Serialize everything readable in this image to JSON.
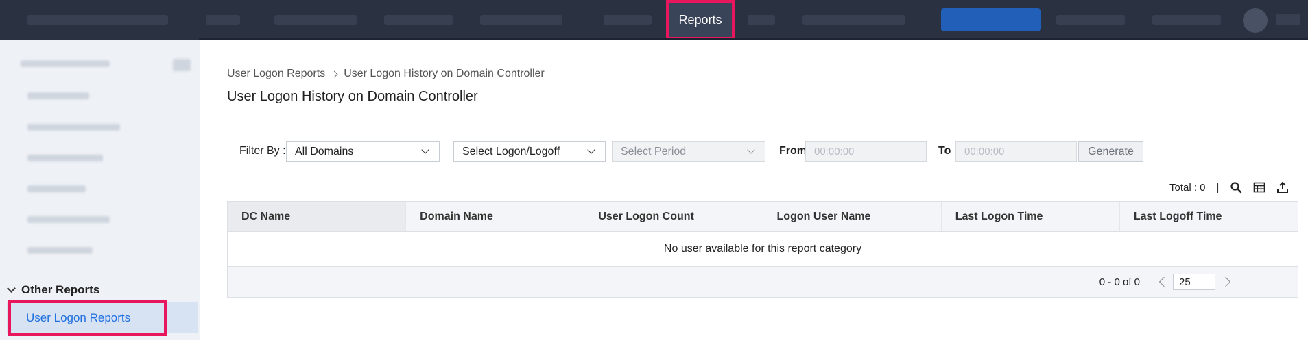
{
  "topnav": {
    "active_tab": "Reports"
  },
  "sidebar": {
    "group": "Other Reports",
    "active_item": "User Logon Reports"
  },
  "breadcrumb": {
    "parent": "User Logon Reports",
    "current": "User Logon History on Domain Controller"
  },
  "page": {
    "title": "User Logon History on Domain Controller"
  },
  "filters": {
    "filter_by_label": "Filter By :",
    "domain_value": "All Domains",
    "logon_value": "Select Logon/Logoff",
    "period_value": "Select Period",
    "from_label": "From",
    "from_placeholder": "00:00:00",
    "to_label": "To",
    "to_placeholder": "00:00:00",
    "generate_label": "Generate"
  },
  "toolbar": {
    "total": "Total : 0",
    "separator": "|",
    "icons": [
      "search-icon",
      "columns-icon",
      "export-icon"
    ]
  },
  "table": {
    "columns": [
      "DC Name",
      "Domain Name",
      "User Logon Count",
      "Logon User Name",
      "Last Logon Time",
      "Last Logoff Time"
    ],
    "empty_message": "No user available for this report category"
  },
  "pagination": {
    "range": "0 - 0 of 0",
    "page_size": "25"
  },
  "colors": {
    "topnav_bg": "#2a3140",
    "highlight": "#e8175d",
    "link_blue": "#1f6fe0",
    "sidebar_active_bg": "#d7e3f3"
  }
}
